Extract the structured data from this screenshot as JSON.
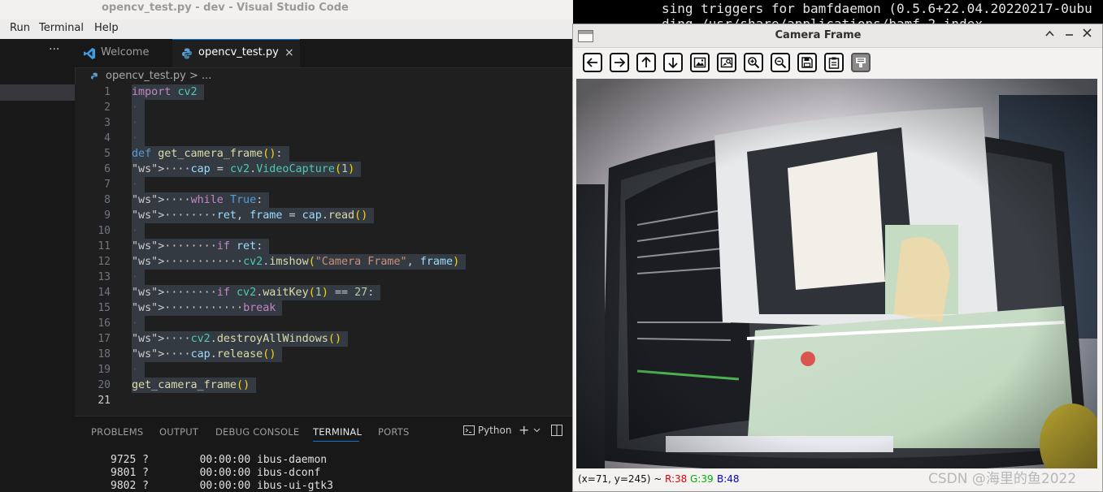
{
  "background_terminal": {
    "lines": [
      "sing triggers for bamfdaemon (0.5.6+22.04.20220217-0ubu",
      "ding /usr/share/applications/bamf-2.index..."
    ]
  },
  "vscode": {
    "window_title": "opencv_test.py - dev - Visual Studio Code",
    "menu": [
      "Run",
      "Terminal",
      "Help"
    ],
    "sidebar": {
      "more_label": "···"
    },
    "tabs": [
      {
        "label": "Welcome",
        "icon": "vscode-logo-icon",
        "active": false
      },
      {
        "label": "opencv_test.py",
        "icon": "python-file-icon",
        "active": true,
        "close": "×"
      }
    ],
    "breadcrumb": "opencv_test.py > ...",
    "line_numbers": [
      "1",
      "2",
      "3",
      "4",
      "5",
      "6",
      "7",
      "8",
      "9",
      "10",
      "11",
      "12",
      "13",
      "14",
      "15",
      "16",
      "17",
      "18",
      "19",
      "20",
      "21"
    ],
    "current_line": "21",
    "code_lines": [
      "import cv2",
      "",
      "",
      "",
      "def get_camera_frame():",
      "    cap = cv2.VideoCapture(1)",
      "",
      "    while True:",
      "        ret, frame = cap.read()",
      "",
      "        if ret:",
      "            cv2.imshow(\"Camera Frame\", frame)",
      "",
      "        if cv2.waitKey(1) == 27:",
      "            break",
      "",
      "    cv2.destroyAllWindows()",
      "    cap.release()",
      "",
      "get_camera_frame()",
      ""
    ],
    "panel": {
      "tabs": [
        "PROBLEMS",
        "OUTPUT",
        "DEBUG CONSOLE",
        "TERMINAL",
        "PORTS"
      ],
      "active_tab": "TERMINAL",
      "shell_label": "Python",
      "add_label": "+",
      "terminal_rows": [
        {
          "pid": "9725",
          "tty": "?",
          "time": "00:00:00",
          "cmd": "ibus-daemon"
        },
        {
          "pid": "9801",
          "tty": "?",
          "time": "00:00:00",
          "cmd": "ibus-dconf"
        },
        {
          "pid": "9802",
          "tty": "?",
          "time": "00:00:00",
          "cmd": "ibus-ui-gtk3"
        }
      ]
    }
  },
  "camera_window": {
    "title": "Camera Frame",
    "toolbar": [
      {
        "name": "pan-left-button",
        "icon": "arrow-left-icon"
      },
      {
        "name": "pan-right-button",
        "icon": "arrow-right-icon"
      },
      {
        "name": "pan-up-button",
        "icon": "arrow-up-icon"
      },
      {
        "name": "pan-down-button",
        "icon": "arrow-down-icon"
      },
      {
        "name": "zoom-to-fit-button",
        "icon": "image-icon"
      },
      {
        "name": "zoom-original-button",
        "icon": "image-zoom-icon"
      },
      {
        "name": "zoom-in-button",
        "icon": "zoom-in-icon"
      },
      {
        "name": "zoom-out-button",
        "icon": "zoom-out-icon"
      },
      {
        "name": "save-image-button",
        "icon": "save-icon"
      },
      {
        "name": "copy-clipboard-button",
        "icon": "clipboard-icon"
      },
      {
        "name": "properties-button",
        "icon": "properties-icon",
        "disabled": true
      }
    ],
    "status": {
      "coords": "(x=71, y=245) ~",
      "r": "R:38",
      "g": "G:39",
      "b": "B:48"
    },
    "status_colors": {
      "r": "#e00000",
      "g": "#00b000",
      "b": "#0000e0"
    }
  },
  "watermark": "CSDN @海里的鱼2022"
}
